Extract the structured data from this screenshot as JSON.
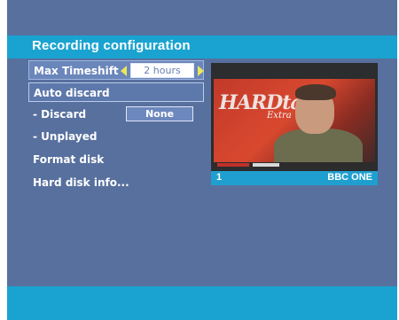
{
  "header": {
    "title": "Recording configuration"
  },
  "menu": {
    "max_timeshift": {
      "label": "Max Timeshift",
      "value": "2 hours"
    },
    "auto_discard": {
      "label": "Auto discard"
    },
    "discard": {
      "label": "- Discard",
      "value": "None"
    },
    "unplayed": {
      "label": "- Unplayed"
    },
    "format_disk": {
      "label": "Format disk"
    },
    "hard_disk_info": {
      "label": "Hard disk info..."
    }
  },
  "preview": {
    "logo_text": "HARDtalk",
    "logo_sub": "Extra",
    "channel_number": "1",
    "channel_name": "BBC ONE"
  },
  "colors": {
    "background": "#57709e",
    "accent": "#1aa3d0",
    "arrow": "#e8e85a"
  },
  "icons": [
    "arrow-left-icon",
    "arrow-right-icon"
  ]
}
